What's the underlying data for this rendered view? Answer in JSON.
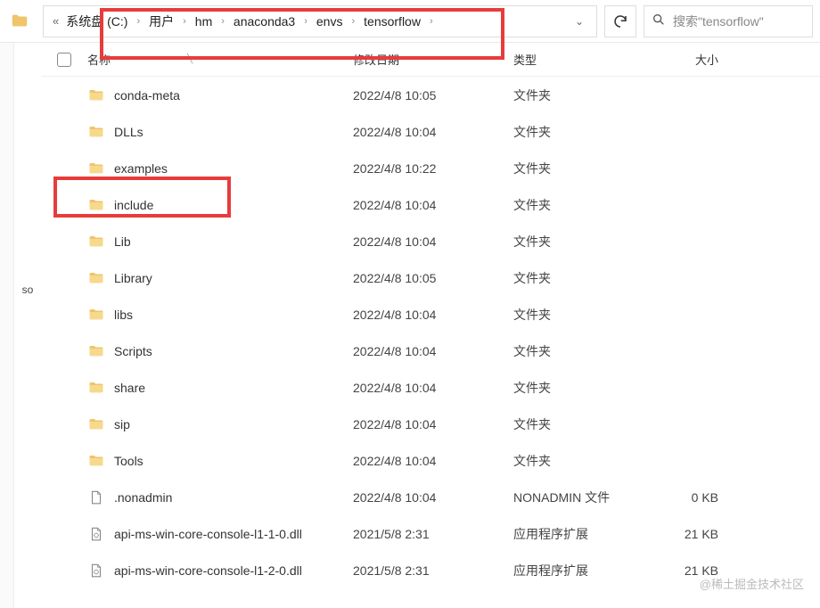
{
  "breadcrumb": {
    "prefix": "«",
    "items": [
      "系统盘 (C:)",
      "用户",
      "hm",
      "anaconda3",
      "envs",
      "tensorflow"
    ]
  },
  "search": {
    "placeholder": "搜索\"tensorflow\""
  },
  "columns": {
    "name": "名称",
    "date": "修改日期",
    "type": "类型",
    "size": "大小"
  },
  "sidebar_text": "so",
  "rows": [
    {
      "icon": "folder",
      "name": "conda-meta",
      "date": "2022/4/8 10:05",
      "type": "文件夹",
      "size": ""
    },
    {
      "icon": "folder",
      "name": "DLLs",
      "date": "2022/4/8 10:04",
      "type": "文件夹",
      "size": ""
    },
    {
      "icon": "folder",
      "name": "examples",
      "date": "2022/4/8 10:22",
      "type": "文件夹",
      "size": ""
    },
    {
      "icon": "folder",
      "name": "include",
      "date": "2022/4/8 10:04",
      "type": "文件夹",
      "size": ""
    },
    {
      "icon": "folder",
      "name": "Lib",
      "date": "2022/4/8 10:04",
      "type": "文件夹",
      "size": ""
    },
    {
      "icon": "folder",
      "name": "Library",
      "date": "2022/4/8 10:05",
      "type": "文件夹",
      "size": ""
    },
    {
      "icon": "folder",
      "name": "libs",
      "date": "2022/4/8 10:04",
      "type": "文件夹",
      "size": ""
    },
    {
      "icon": "folder",
      "name": "Scripts",
      "date": "2022/4/8 10:04",
      "type": "文件夹",
      "size": ""
    },
    {
      "icon": "folder",
      "name": "share",
      "date": "2022/4/8 10:04",
      "type": "文件夹",
      "size": ""
    },
    {
      "icon": "folder",
      "name": "sip",
      "date": "2022/4/8 10:04",
      "type": "文件夹",
      "size": ""
    },
    {
      "icon": "folder",
      "name": "Tools",
      "date": "2022/4/8 10:04",
      "type": "文件夹",
      "size": ""
    },
    {
      "icon": "file",
      "name": ".nonadmin",
      "date": "2022/4/8 10:04",
      "type": "NONADMIN 文件",
      "size": "0 KB"
    },
    {
      "icon": "dll",
      "name": "api-ms-win-core-console-l1-1-0.dll",
      "date": "2021/5/8 2:31",
      "type": "应用程序扩展",
      "size": "21 KB"
    },
    {
      "icon": "dll",
      "name": "api-ms-win-core-console-l1-2-0.dll",
      "date": "2021/5/8 2:31",
      "type": "应用程序扩展",
      "size": "21 KB"
    }
  ],
  "watermark": "@稀土掘金技术社区"
}
